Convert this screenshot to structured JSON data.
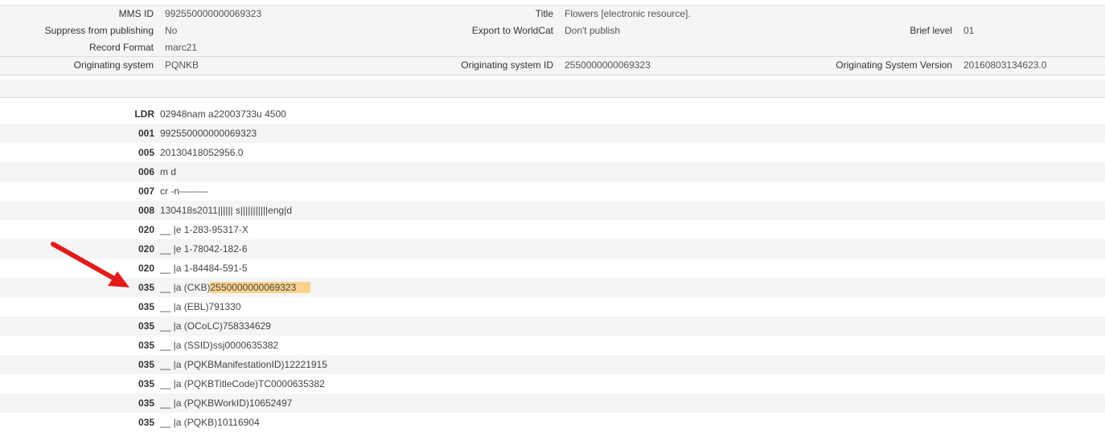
{
  "record": {
    "mms_id_label": "MMS ID",
    "mms_id_value": "992550000000069323",
    "title_label": "Title",
    "title_value": "Flowers [electronic resource].",
    "suppress_label": "Suppress from publishing",
    "suppress_value": "No",
    "export_label": "Export to WorldCat",
    "export_value": "Don't publish",
    "brief_label": "Brief level",
    "brief_value": "01",
    "format_label": "Record Format",
    "format_value": "marc21",
    "orig_sys_label": "Originating system",
    "orig_sys_value": "PQNKB",
    "orig_sys_id_label": "Originating system ID",
    "orig_sys_id_value": "2550000000069323",
    "orig_sys_ver_label": "Originating System Version",
    "orig_sys_ver_value": "20160803134623.0"
  },
  "marc_fields": [
    {
      "tag": "LDR",
      "content": "02948nam a22003733u 4500"
    },
    {
      "tag": "001",
      "content": "992550000000069323"
    },
    {
      "tag": "005",
      "content": "20130418052956.0"
    },
    {
      "tag": "006",
      "content": "m d"
    },
    {
      "tag": "007",
      "content": "cr -n---------"
    },
    {
      "tag": "008",
      "content": "130418s2011|||||| s|||||||||||eng|d"
    },
    {
      "tag": "020",
      "content": "__ |e 1-283-95317-X"
    },
    {
      "tag": "020",
      "content": "__ |e 1-78042-182-6"
    },
    {
      "tag": "020",
      "content": "__ |a 1-84484-591-5"
    },
    {
      "tag": "035",
      "content_prefix": "__ |a (CKB)",
      "content_highlight": "2550000000069323"
    },
    {
      "tag": "035",
      "content": "__ |a (EBL)791330"
    },
    {
      "tag": "035",
      "content": "__ |a (OCoLC)758334629"
    },
    {
      "tag": "035",
      "content": "__ |a (SSID)ssj0000635382"
    },
    {
      "tag": "035",
      "content": "__ |a (PQKBManifestationID)12221915"
    },
    {
      "tag": "035",
      "content": "__ |a (PQKBTitleCode)TC0000635382"
    },
    {
      "tag": "035",
      "content": "__ |a (PQKBWorkID)10652497"
    },
    {
      "tag": "035",
      "content": "__ |a (PQKB)10116904"
    }
  ],
  "colors": {
    "highlight": "#fbd38d",
    "arrow": "#e21b1b"
  }
}
